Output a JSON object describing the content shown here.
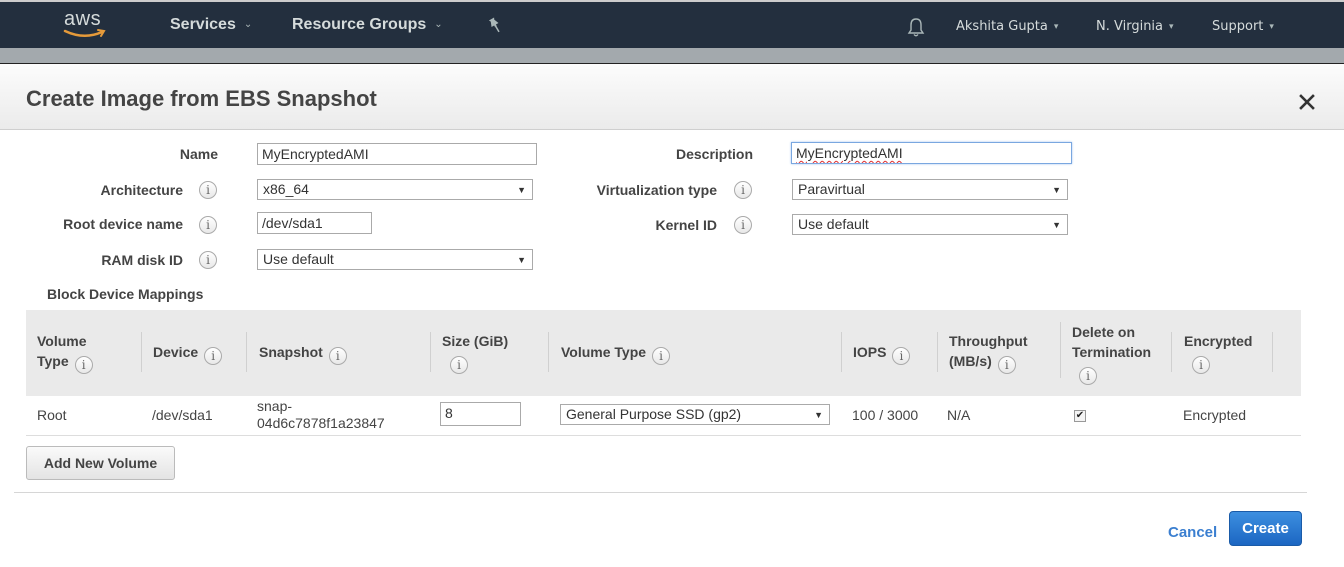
{
  "nav": {
    "logo_text": "aws",
    "services": "Services",
    "resource_groups": "Resource Groups",
    "user": "Akshita Gupta",
    "region": "N. Virginia",
    "support": "Support",
    "icons": {
      "pin": "pin-icon",
      "bell": "bell-icon",
      "chevron": "chevron-down-icon"
    }
  },
  "modal": {
    "title": "Create Image from EBS Snapshot",
    "close_icon": "close-icon",
    "form": {
      "name": {
        "label": "Name",
        "value": "MyEncryptedAMI"
      },
      "description": {
        "label": "Description",
        "value": "MyEncryptedAMI"
      },
      "architecture": {
        "label": "Architecture",
        "value": "x86_64"
      },
      "virtualization_type": {
        "label": "Virtualization type",
        "value": "Paravirtual"
      },
      "root_device_name": {
        "label": "Root device name",
        "value": "/dev/sda1"
      },
      "kernel_id": {
        "label": "Kernel ID",
        "value": "Use default"
      },
      "ram_disk_id": {
        "label": "RAM disk ID",
        "value": "Use default"
      }
    },
    "block_device_mappings": {
      "title": "Block Device Mappings",
      "headers": {
        "volume_type_l1": "Volume",
        "volume_type_l2": "Type",
        "device": "Device",
        "snapshot": "Snapshot",
        "size": "Size (GiB)",
        "ebs_volume_type": "Volume Type",
        "iops": "IOPS",
        "throughput_l1": "Throughput",
        "throughput_l2": "(MB/s)",
        "delete_l1": "Delete on",
        "delete_l2": "Termination",
        "encrypted": "Encrypted"
      },
      "rows": [
        {
          "volume_type": "Root",
          "device": "/dev/sda1",
          "snapshot_l1": "snap-",
          "snapshot_l2": "04d6c7878f1a23847",
          "size": "8",
          "ebs_volume_type": "General Purpose SSD (gp2)",
          "iops": "100 / 3000",
          "throughput": "N/A",
          "delete_on_termination": true,
          "encrypted": "Encrypted"
        }
      ],
      "add_button": "Add New Volume"
    },
    "footer": {
      "cancel": "Cancel",
      "create": "Create"
    },
    "colors": {
      "nav_bg": "#232f3e",
      "primary_button": "#1c66c2",
      "link": "#3b7fd0"
    }
  }
}
